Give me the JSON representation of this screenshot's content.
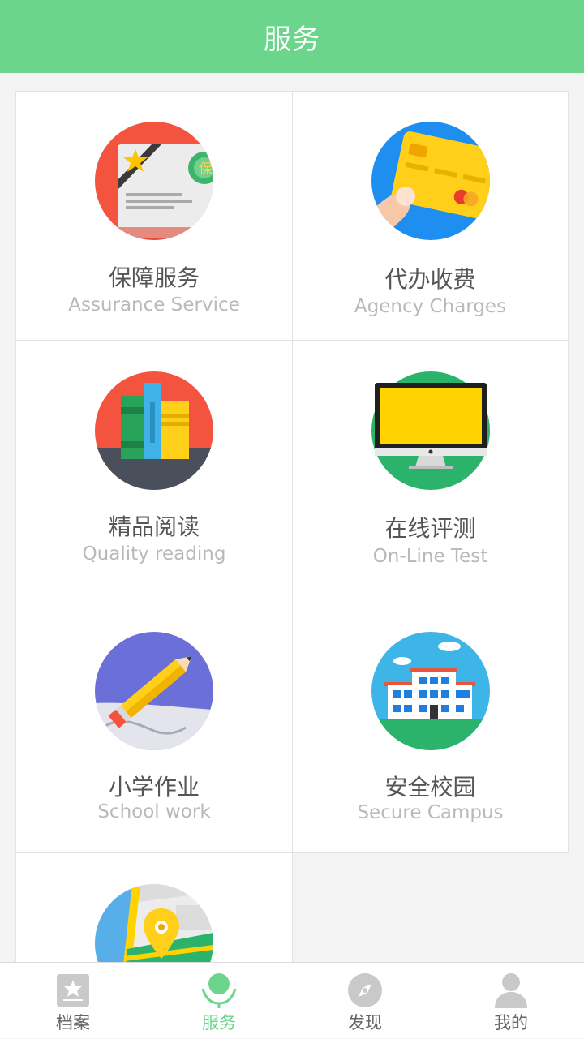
{
  "header": {
    "title": "服务"
  },
  "services": [
    {
      "title": "保障服务",
      "subtitle": "Assurance Service",
      "icon": "assurance-card-icon",
      "badge": "保"
    },
    {
      "title": "代办收费",
      "subtitle": "Agency Charges",
      "icon": "credit-card-icon"
    },
    {
      "title": "精品阅读",
      "subtitle": "Quality reading",
      "icon": "books-icon"
    },
    {
      "title": "在线评测",
      "subtitle": "On-Line Test",
      "icon": "monitor-icon"
    },
    {
      "title": "小学作业",
      "subtitle": "School work",
      "icon": "pencil-icon"
    },
    {
      "title": "安全校园",
      "subtitle": "Secure Campus",
      "icon": "school-building-icon"
    },
    {
      "title": "",
      "subtitle": "",
      "icon": "map-pin-icon"
    }
  ],
  "tabbar": {
    "items": [
      {
        "label": "档案",
        "icon": "archive-star-icon",
        "active": false
      },
      {
        "label": "服务",
        "icon": "service-person-icon",
        "active": true
      },
      {
        "label": "发现",
        "icon": "compass-icon",
        "active": false
      },
      {
        "label": "我的",
        "icon": "user-profile-icon",
        "active": false
      }
    ]
  },
  "colors": {
    "accent": "#6bd68b",
    "background": "#f4f4f4",
    "title_text": "#555555",
    "subtitle_text": "#b9b9b9"
  }
}
